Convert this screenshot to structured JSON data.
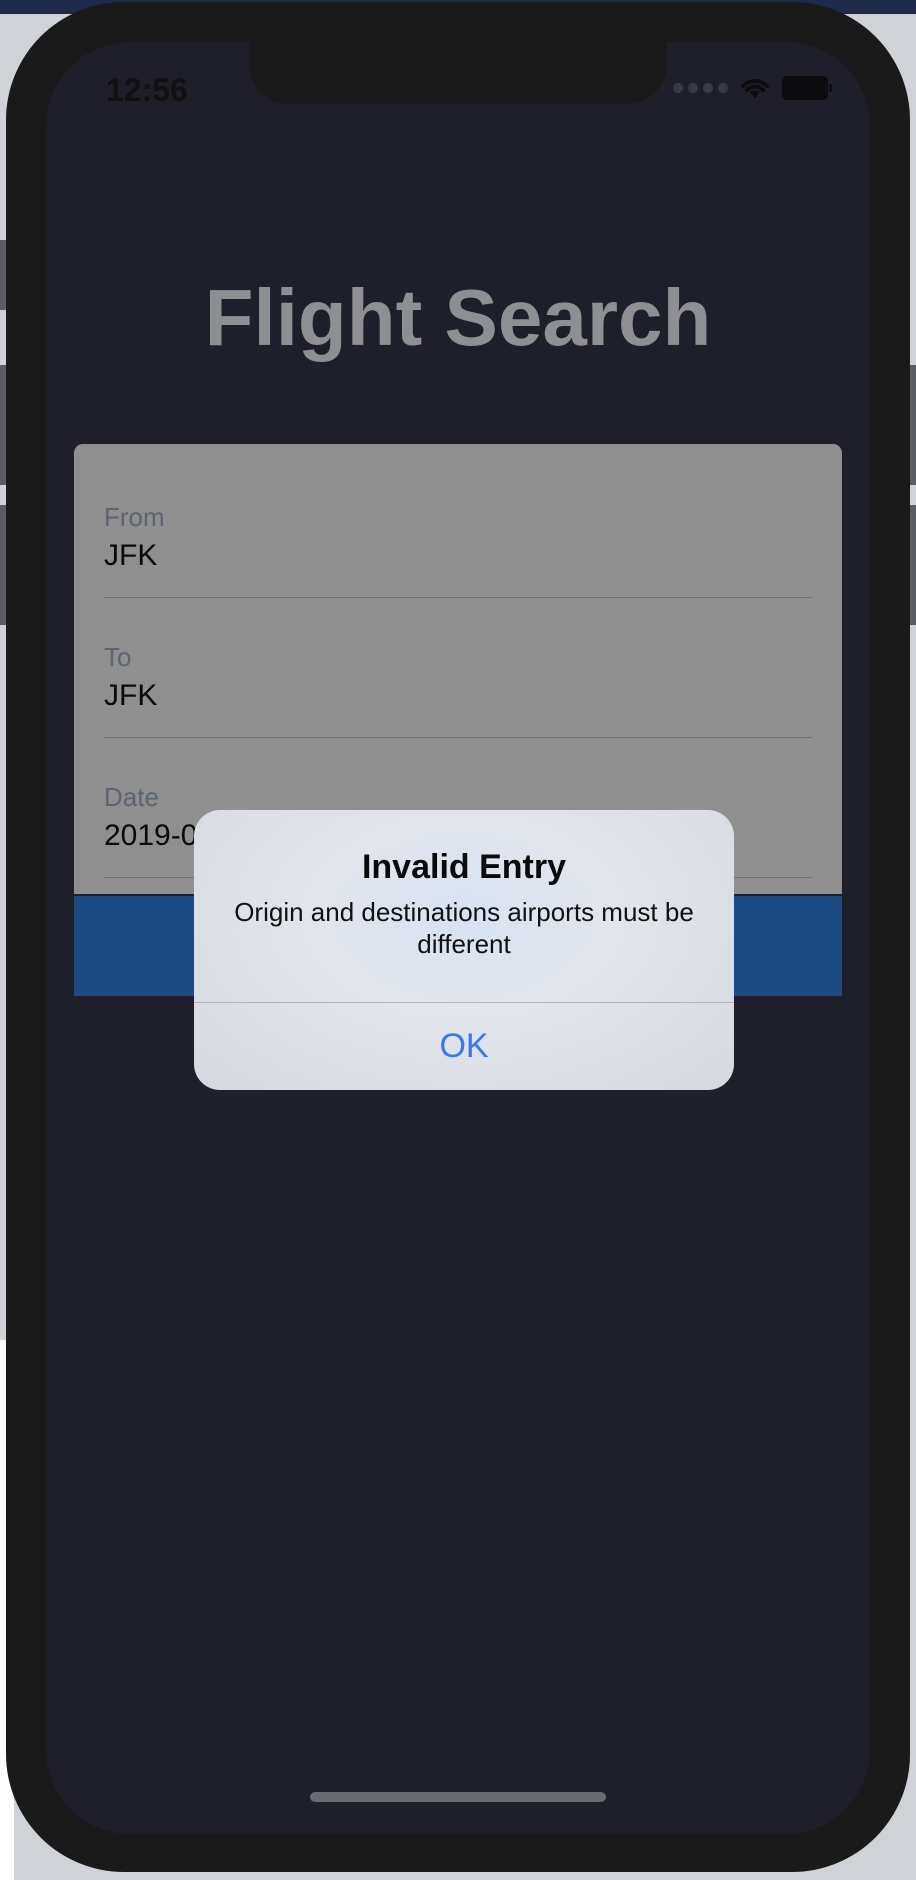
{
  "status_bar": {
    "time": "12:56"
  },
  "screen": {
    "title": "Flight Search"
  },
  "form": {
    "from_label": "From",
    "from_value": "JFK",
    "to_label": "To",
    "to_value": "JFK",
    "date_label": "Date",
    "date_value": "2019-09-12"
  },
  "alert": {
    "title": "Invalid Entry",
    "message": "Origin and destinations airports must be different",
    "ok_label": "OK"
  },
  "colors": {
    "background": "#1e1f2b",
    "search_button": "#1d4a80",
    "alert_action": "#3478f6"
  }
}
